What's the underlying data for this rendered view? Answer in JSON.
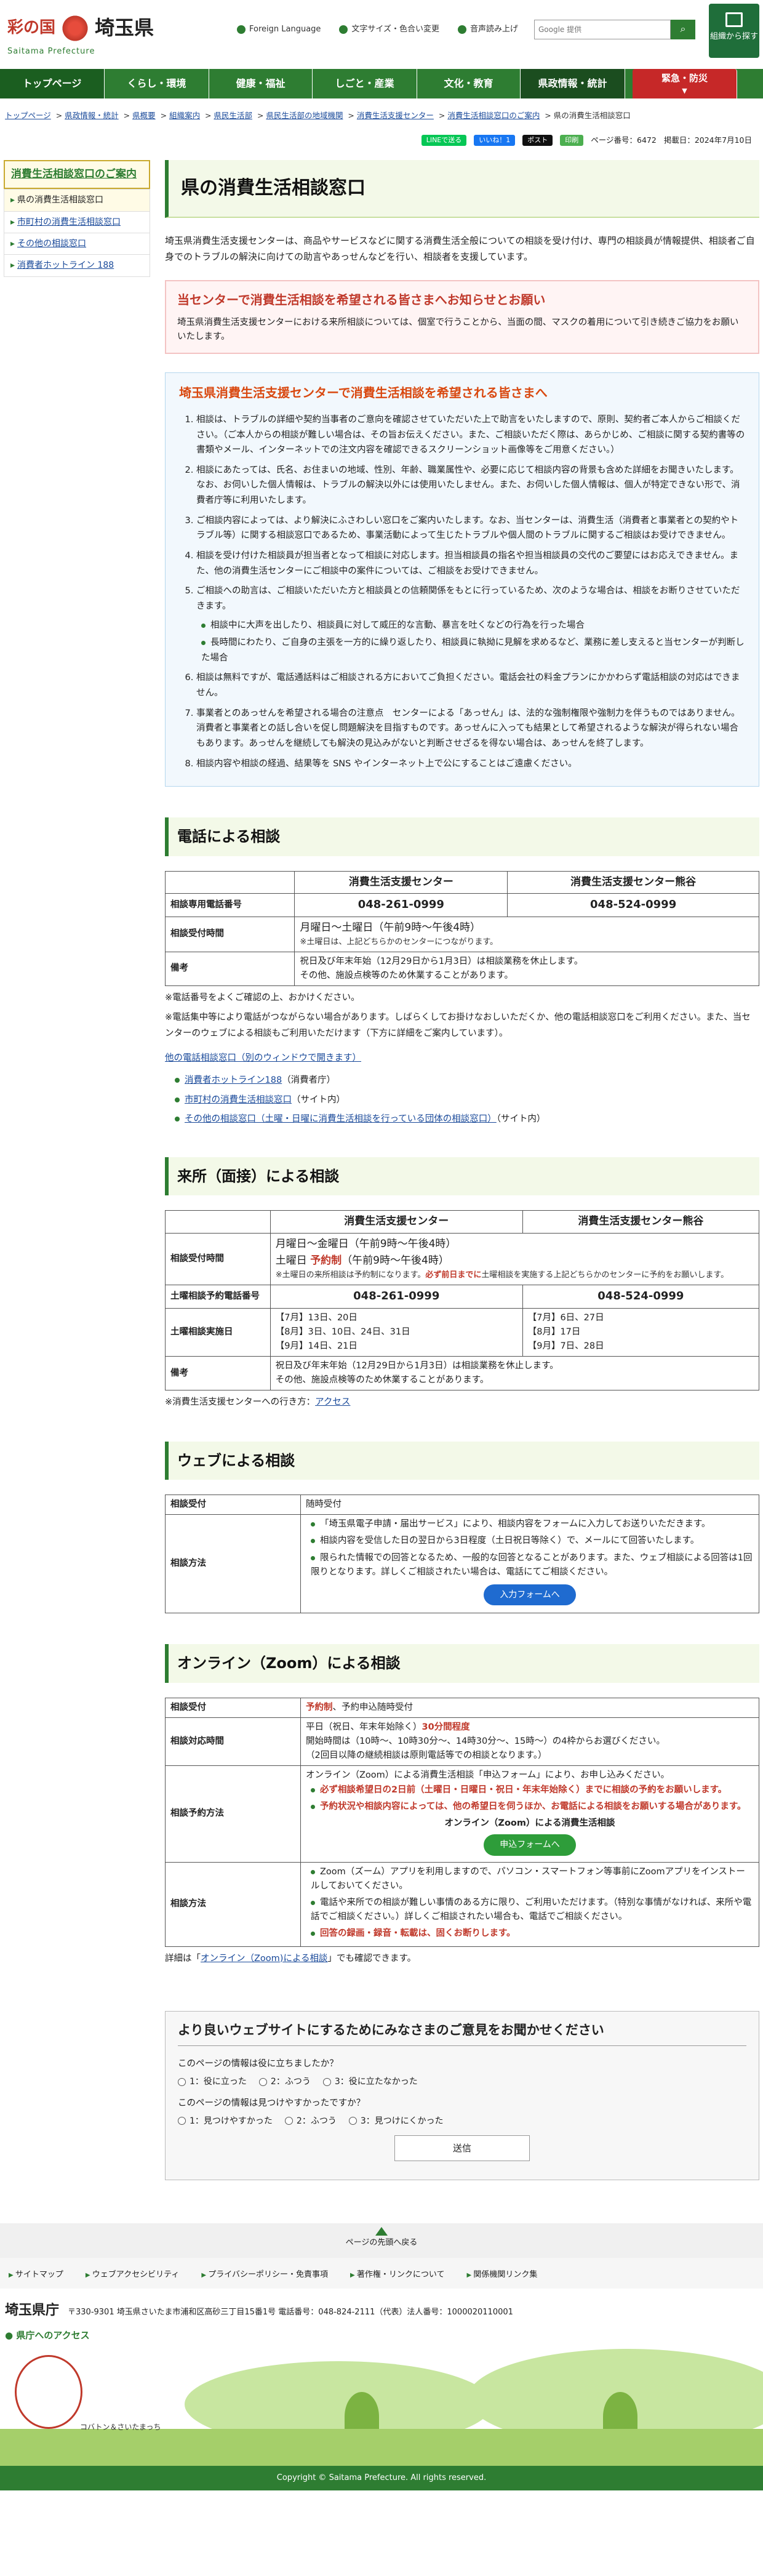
{
  "header": {
    "brand": "彩の国",
    "pref": "埼玉県",
    "roman": "Saitama Prefecture",
    "foreign": "Foreign Language",
    "fontsize": "文字サイズ・色合い変更",
    "voice": "音声読み上げ",
    "search_placeholder": "Google 提供",
    "org_label": "組織から探す"
  },
  "nav": [
    "トップページ",
    "くらし・環境",
    "健康・福祉",
    "しごと・産業",
    "文化・教育",
    "県政情報・統計"
  ],
  "emergency": {
    "label": "緊急・防災",
    "sub": "▼"
  },
  "breadcrumb": [
    "トップページ",
    "県政情報・統計",
    "県概要",
    "組織案内",
    "県民生活部",
    "県民生活部の地域機関",
    "消費生活支援センター",
    "消費生活相談窓口のご案内",
    "県の消費生活相談窓口"
  ],
  "share": {
    "line": "LINEで送る",
    "fb": "いいね！1",
    "x": "ポスト",
    "eng": "印刷",
    "page_no": "ページ番号：6472",
    "date": "掲載日：2024年7月10日"
  },
  "side": {
    "title": "消費生活相談窓口のご案内",
    "items": [
      "県の消費生活相談窓口",
      "市町村の消費生活相談窓口",
      "その他の相談窓口",
      "消費者ホットライン 188"
    ]
  },
  "page_title": "県の消費生活相談窓口",
  "lead": "埼玉県消費生活支援センターは、商品やサービスなどに関する消費生活全般についての相談を受け付け、専門の相談員が情報提供、相談者ご自身でのトラブルの解決に向けての助言やあっせんなどを行い、相談者を支援しています。",
  "notice": {
    "title": "当センターで消費生活相談を希望される皆さまへお知らせとお願い",
    "text": "埼玉県消費生活支援センターにおける来所相談については、個室で行うことから、当面の間、マスクの着用について引き続きご協力をお願いいたします。"
  },
  "warn": {
    "title": "埼玉県消費生活支援センターで消費生活相談を希望される皆さまへ",
    "items": [
      "相談は、トラブルの詳細や契約当事者のご意向を確認させていただいた上で助言をいたしますので、原則、契約者ご本人からご相談ください。（ご本人からの相談が難しい場合は、その旨お伝えください。また、ご相談いただく際は、あらかじめ、ご相談に関する契約書等の書類やメール、インターネットでの注文内容を確認できるスクリーンショット画像等をご用意ください。）",
      "相談にあたっては、氏名、お住まいの地域、性別、年齢、職業属性や、必要に応じて相談内容の背景も含めた詳細をお聞きいたします。なお、お伺いした個人情報は、トラブルの解決以外には使用いたしません。また、お伺いした個人情報は、個人が特定できない形で、消費者庁等に利用いたします。",
      "ご相談内容によっては、より解決にふさわしい窓口をご案内いたします。なお、当センターは、消費生活（消費者と事業者との契約やトラブル等）に関する相談窓口であるため、事業活動によって生じたトラブルや個人間のトラブルに関するご相談はお受けできません。",
      "相談を受け付けた相談員が担当者となって相談に対応します。担当相談員の指名や担当相談員の交代のご要望にはお応えできません。また、他の消費生活センターにご相談中の案件については、ご相談をお受けできません。",
      "ご相談への助言は、ご相談いただいた方と相談員との信頼関係をもとに行っているため、次のような場合は、相談をお断りさせていただきます。",
      "相談は無料ですが、電話通話料はご相談される方においてご負担ください。電話会社の料金プランにかかわらず電話相談の対応はできません。",
      "事業者とのあっせんを希望される場合の注意点　センターによる「あっせん」は、法的な強制権限や強制力を伴うものではありません。消費者と事業者との話し合いを促し問題解決を目指すものです。あっせんに入っても結果として希望されるような解決が得られない場合もあります。あっせんを継続しても解決の見込みがないと判断させざるを得ない場合は、あっせんを終了します。",
      "相談内容や相談の経過、結果等を SNS やインターネット上で公にすることはご遠慮ください。"
    ],
    "sub": [
      "相談中に大声を出したり、相談員に対して威圧的な言動、暴言を吐くなどの行為を行った場合",
      "長時間にわたり、ご自身の主張を一方的に繰り返したり、相談員に執拗に見解を求めるなど、業務に差し支えると当センターが判断した場合"
    ]
  },
  "phone": {
    "title": "電話による相談",
    "col1": "消費生活支援センター",
    "col2": "消費生活支援センター熊谷",
    "r1": "相談専用電話番号",
    "tel1": "048-261-0999",
    "tel2": "048-524-0999",
    "r2": "相談受付時間",
    "hours": "月曜日～土曜日（午前9時～午後4時）",
    "hours_note": "※土曜日は、上記どちらかのセンターにつながります。",
    "r3": "備考",
    "remark1": "祝日及び年末年始（12月29日から1月3日）は相談業務を休止します。",
    "remark2": "その他、施設点検等のため休業することがあります。",
    "note1": "※電話番号をよくご確認の上、おかけください。",
    "note2": "※電話集中等により電話がつながらない場合があります。しばらくしてお掛けなおしいただくか、他の電話相談窓口をご利用ください。また、当センターのウェブによる相談もご利用いただけます（下方に詳細をご案内しています）。",
    "other_label": "他の電話相談窓口（別のウィンドウで開きます）",
    "links": [
      "消費者ホットライン188",
      "市町村の消費生活相談窓口",
      "その他の相談窓口（土曜・日曜に消費生活相談を行っている団体の相談窓口）"
    ],
    "link_tags": [
      "（消費者庁）",
      "（サイト内）",
      "（サイト内）"
    ]
  },
  "visit": {
    "title": "来所（面接）による相談",
    "r1": "相談受付時間",
    "hours1": "月曜日～金曜日（午前9時～午後4時）",
    "hours2a": "土曜日",
    "hours2b": "予約制",
    "hours2c": "（午前9時～午後4時）",
    "hours_note": "※土曜日の来所相談は予約制になります。",
    "hours_note_red": "必ず前日までに",
    "hours_note2": "土曜相談を実施する上記どちらかのセンターに予約をお願いします。",
    "r2": "土曜相談予約電話番号",
    "tel1": "048-261-0999",
    "tel2": "048-524-0999",
    "r3": "土曜相談実施日",
    "d1": "【7月】13日、20日",
    "d2": "【8月】3日、10日、24日、31日",
    "d3": "【9月】14日、21日",
    "e1": "【7月】6日、27日",
    "e2": "【8月】17日",
    "e3": "【9月】7日、28日",
    "r4": "備考",
    "remark1": "祝日及び年末年始（12月29日から1月3日）は相談業務を休止します。",
    "remark2": "その他、施設点検等のため休業することがあります。",
    "access_prefix": "※消費生活支援センターへの行き方：",
    "access": "アクセス"
  },
  "web": {
    "title": "ウェブによる相談",
    "r1": "相談受付",
    "v1": "随時受付",
    "r2": "相談方法",
    "items": [
      "「埼玉県電子申請・届出サービス」により、相談内容をフォームに入力してお送りいただきます。",
      "相談内容を受信した日の翌日から3日程度（土日祝日等除く）で、メールにて回答いたします。",
      "限られた情報での回答となるため、一般的な回答となることがあります。また、ウェブ相談による回答は1回限りとなります。詳しくご相談されたい場合は、電話にてご相談ください。"
    ],
    "button": "入力フォームへ"
  },
  "zoom": {
    "title": "オンライン（Zoom）による相談",
    "r1": "相談受付",
    "v1a": "予約制",
    "v1b": "、予約申込随時受付",
    "r2": "相談対応時間",
    "v2a": "平日（祝日、年末年始除く）",
    "v2b": "30分間程度",
    "v2c": "開始時間は（10時～、10時30分～、14時30分～、15時～）の4枠からお選びください。",
    "v2d": "（2回目以降の継続相談は原則電話等での相談となります。）",
    "r3": "相談予約方法",
    "v3a": "オンライン（Zoom）による消費生活相談「申込フォーム」により、お申し込みください。",
    "v3b": "必ず相談希望日の2日前（土曜日・日曜日・祝日・年末年始除く）までに相談の予約をお願いします。",
    "v3c": "予約状況や相談内容によっては、他の希望日を伺うほか、お電話による相談をお願いする場合があります。",
    "v3d": "オンライン（Zoom）による消費生活相談",
    "button": "申込フォームへ",
    "r4": "相談方法",
    "v4a": "Zoom（ズーム）アプリを利用しますので、パソコン・スマートフォン等事前にZoomアプリをインストールしておいてください。",
    "v4b": "電話や来所での相談が難しい事情のある方に限り、ご利用いただけます。（特別な事情がなければ、来所や電話でご相談ください。）詳しくご相談されたい場合も、電話でご相談ください。",
    "v4c": "回答の録画・録音・転載は、固くお断りします。",
    "detail_prefix": "詳細は「",
    "detail_link": "オンライン（Zoom)による相談",
    "detail_suffix": "」でも確認できます。"
  },
  "survey": {
    "title": "より良いウェブサイトにするためにみなさまのご意見をお聞かせください",
    "q1": "このページの情報は役に立ちましたか？",
    "o1": [
      "1：役に立った",
      "2：ふつう",
      "3：役に立たなかった"
    ],
    "q2": "このページの情報は見つけやすかったですか？",
    "o2": [
      "1：見つけやすかった",
      "2：ふつう",
      "3：見つけにくかった"
    ],
    "send": "送信"
  },
  "footer": {
    "pagetop": "ページの先頭へ戻る",
    "links": [
      "サイトマップ",
      "ウェブアクセシビリティ",
      "プライバシーポリシー・免責事項",
      "著作権・リンクについて",
      "関係機関リンク集"
    ],
    "office": "埼玉県庁",
    "address": "〒330-9301 埼玉県さいたま市浦和区高砂三丁目15番1号 電話番号：048-824-2111（代表）法人番号：1000020110001",
    "access": "県庁へのアクセス",
    "mascot": "コバトン＆さいたまっち",
    "copy": "Copyright © Saitama Prefecture. All rights reserved."
  }
}
